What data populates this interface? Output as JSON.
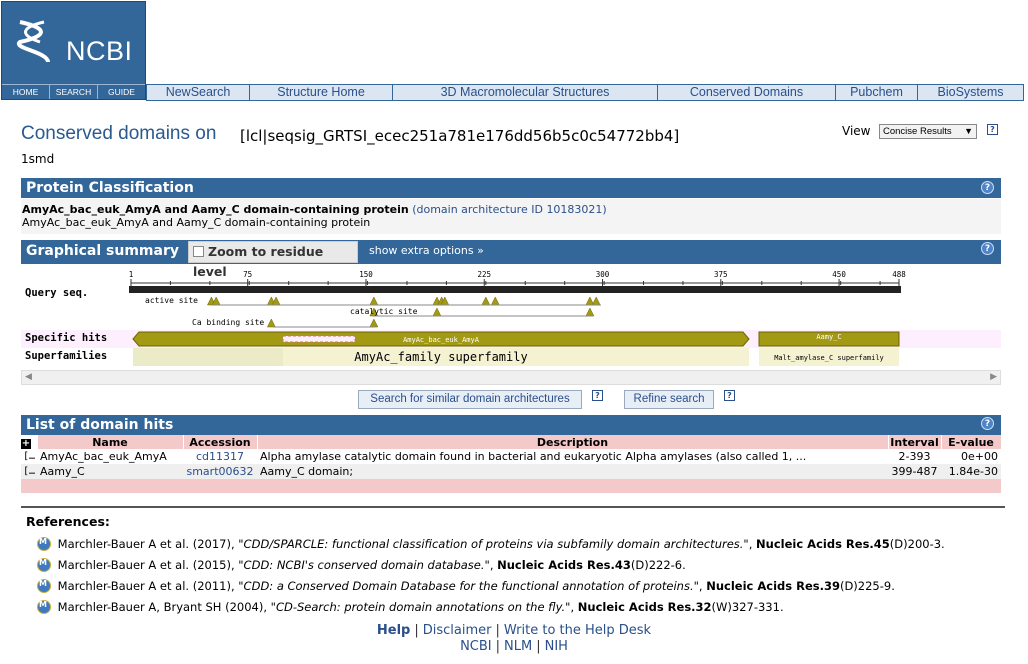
{
  "header": {
    "logo_text": "NCBI",
    "logo_nav": [
      "HOME",
      "SEARCH",
      "GUIDE"
    ],
    "nav": [
      "NewSearch",
      "Structure Home",
      "3D Macromolecular Structures",
      "Conserved Domains",
      "Pubchem",
      "BioSystems"
    ]
  },
  "title": {
    "main": "Conserved domains on",
    "query_id": "[lcl|seqsig_GRTSI_ecec251a781e176dd56b5c0c54772bb4]",
    "sub": "1smd",
    "view_label": "View",
    "view_value": "Concise Results"
  },
  "classification": {
    "header": "Protein Classification",
    "protein_name": "AmyAc_bac_euk_AmyA and Aamy_C domain-containing protein",
    "arch_link": "(domain architecture ID 10183021)",
    "desc": "AmyAc_bac_euk_AmyA and Aamy_C domain-containing protein"
  },
  "graphical": {
    "header": "Graphical summary",
    "zoom_label": "Zoom to residue level",
    "extra_options": "show extra options »",
    "ruler_ticks": [
      "1",
      "75",
      "150",
      "225",
      "300",
      "375",
      "450",
      "488"
    ],
    "query_label": "Query seq.",
    "active_site": "active site",
    "catalytic_site": "catalytic site",
    "ca_binding": "Ca binding site",
    "specific_label": "Specific hits",
    "super_label": "Superfamilies",
    "specific_hit_1": "AmyAc_bac_euk_AmyA",
    "specific_hit_2": "Aamy_C",
    "superfamily_1": "AmyAc_family superfamily",
    "superfamily_2": "Malt_amylase_C superfamily"
  },
  "graphical_data": {
    "sequence_length": 488,
    "specific_hits": [
      {
        "name": "AmyAc_bac_euk_AmyA",
        "start": 2,
        "end": 393
      },
      {
        "name": "Aamy_C",
        "start": 399,
        "end": 487
      }
    ],
    "active_site_positions": [
      52,
      55,
      90,
      93,
      155,
      195,
      198,
      200,
      226,
      232,
      292,
      296
    ],
    "catalytic_site_positions": [
      155,
      195,
      292
    ],
    "ca_binding_positions": [
      90,
      155
    ]
  },
  "buttons": {
    "similar": "Search for similar domain architectures",
    "refine": "Refine search"
  },
  "hits": {
    "header": "List of domain hits",
    "columns": [
      "Name",
      "Accession",
      "Description",
      "Interval",
      "E-value"
    ],
    "rows": [
      {
        "toggle": "[+]",
        "name": "AmyAc_bac_euk_AmyA",
        "accession": "cd11317",
        "description": "Alpha amylase catalytic domain found in bacterial and eukaryotic Alpha amylases (also called 1, ...",
        "interval": "2-393",
        "evalue": "0e+00"
      },
      {
        "toggle": "[+]",
        "name": "Aamy_C",
        "accession": "smart00632",
        "description": "Aamy_C domain;",
        "interval": "399-487",
        "evalue": "1.84e-30"
      }
    ]
  },
  "references": {
    "title": "References:",
    "items": [
      {
        "authors": "Marchler-Bauer A et al. (2017), ",
        "title": "\"CDD/SPARCLE: functional classification of proteins via subfamily domain architectures.\"",
        "journal": "Nucleic Acids Res.45",
        "pages": "(D)200-3."
      },
      {
        "authors": "Marchler-Bauer A et al. (2015), ",
        "title": "\"CDD: NCBI's conserved domain database.\"",
        "journal": "Nucleic Acids Res.43",
        "pages": "(D)222-6."
      },
      {
        "authors": "Marchler-Bauer A et al. (2011), ",
        "title": "\"CDD: a Conserved Domain Database for the functional annotation of proteins.\"",
        "journal": "Nucleic Acids Res.39",
        "pages": "(D)225-9."
      },
      {
        "authors": "Marchler-Bauer A, Bryant SH (2004), ",
        "title": "\"CD-Search: protein domain annotations on the fly.\"",
        "journal": "Nucleic Acids Res.32",
        "pages": "(W)327-331."
      }
    ]
  },
  "footer": {
    "help": "Help",
    "disclaimer": "Disclaimer",
    "write": "Write to the Help Desk",
    "ncbi": "NCBI",
    "nlm": "NLM",
    "nih": "NIH",
    "sep": "|"
  },
  "colors": {
    "section_header": "#336699",
    "specific_hit": "#a39a14",
    "superfamily": "#f5f2d2",
    "table_header": "#f4c9c9",
    "link": "#2a4f8a"
  }
}
